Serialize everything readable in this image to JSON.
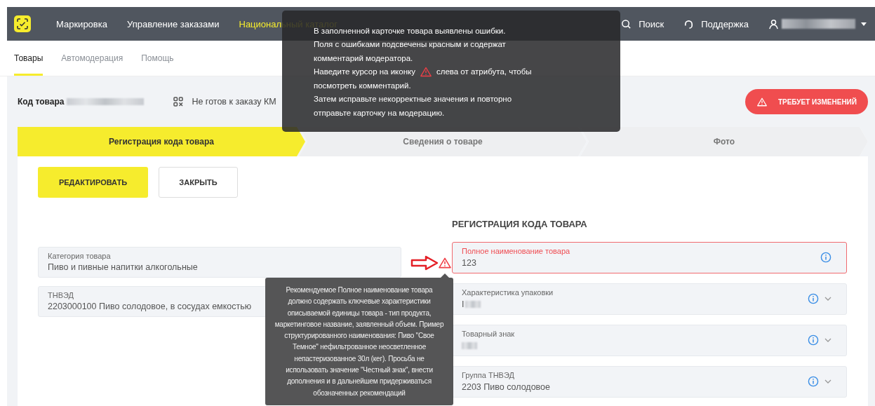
{
  "nav": {
    "items": [
      {
        "label": "Маркировка",
        "selected": false
      },
      {
        "label": "Управление заказами",
        "selected": false
      },
      {
        "label": "Национальный каталог",
        "selected": true
      }
    ],
    "search": "Поиск",
    "support": "Поддержка",
    "user_redacted": true
  },
  "tabs": [
    {
      "label": "Товары",
      "selected": true
    },
    {
      "label": "Автомодерация",
      "selected": false
    },
    {
      "label": "Помощь",
      "selected": false
    }
  ],
  "product": {
    "code_label": "Код товара",
    "code_redacted": true,
    "status": "Не готов к заказу КМ",
    "badge": "ТРЕБУЕТ ИЗМЕНЕНИЙ"
  },
  "steps": [
    {
      "label": "Регистрация кода товара",
      "selected": true
    },
    {
      "label": "Сведения о товаре",
      "selected": false
    },
    {
      "label": "Фото",
      "selected": false
    }
  ],
  "buttons": [
    {
      "label": "РЕДАКТИРОВАТЬ",
      "kind": "primary"
    },
    {
      "label": "ЗАКРЫТЬ",
      "kind": "secondary"
    }
  ],
  "section_title": "РЕГИСТРАЦИЯ КОДА ТОВАРА",
  "left_fields": [
    {
      "label": "Категория товара",
      "value": "Пиво и пивные напитки алкогольные"
    },
    {
      "label": "ТНВЭД",
      "value": "2203000100 Пиво солодовое, в сосудах емкостью"
    }
  ],
  "right_fields": [
    {
      "label": "Полное наименование товара",
      "value": "123",
      "error": true,
      "dropdown": false,
      "redacted": false
    },
    {
      "label": "Характеристика упаковки",
      "value": "I",
      "error": false,
      "dropdown": true,
      "redacted": true
    },
    {
      "label": "Товарный знак",
      "error": false,
      "dropdown": true,
      "redacted": true
    },
    {
      "label": "Группа ТНВЭД",
      "value": "2203 Пиво солодовое",
      "error": false,
      "dropdown": true,
      "redacted": false
    }
  ],
  "notice": {
    "lines": [
      [
        {
          "kind": "text",
          "text": "В заполненной карточке товара выявлены ошибки."
        }
      ],
      [
        {
          "kind": "text",
          "text": "Поля с ошибками подсвечены красным и содержат"
        }
      ],
      [
        {
          "kind": "text",
          "text": "комментарий модератора."
        }
      ],
      [
        {
          "kind": "text",
          "text": "Наведите курсор на иконку"
        },
        {
          "kind": "icon"
        },
        {
          "kind": "text",
          "text": "слева от атрибута, чтобы"
        }
      ],
      [
        {
          "kind": "text",
          "text": "посмотреть комментарий."
        }
      ],
      [
        {
          "kind": "text",
          "text": "Затем исправьте некорректные значения и повторно"
        }
      ],
      [
        {
          "kind": "text",
          "text": "отправьте карточку на модерацию."
        }
      ]
    ]
  },
  "hint": {
    "text": "Рекомендуемое Полное наименование товара должно содержать ключевые характеристики описываемой единицы товара - тип продукта, маркетинговое название, заявленный объем. Пример структурированного наименования: Пиво \"Свое Темное\" нефильтрованное неосветленное непастеризованное 30л (кег). Просьба не использовать значение \"Честный знак\", внести дополнения и в дальнейшем придерживаться обозначенных рекомендаций"
  }
}
